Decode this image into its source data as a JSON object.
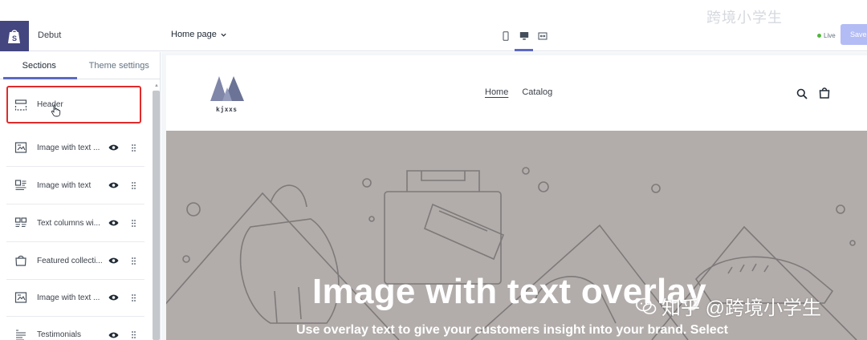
{
  "topbar": {
    "theme_name": "Debut",
    "page_selector": "Home page",
    "live_label": "Live",
    "save_label": "Save",
    "watermark_top": "跨境小学生"
  },
  "sidebar": {
    "tabs": [
      {
        "label": "Sections",
        "active": true
      },
      {
        "label": "Theme settings",
        "active": false
      }
    ],
    "header_item": {
      "label": "Header",
      "icon": "header-layout-icon"
    },
    "items": [
      {
        "label": "Image with text ...",
        "icon": "image-text-icon"
      },
      {
        "label": "Image with text",
        "icon": "image-with-text-icon"
      },
      {
        "label": "Text columns wi...",
        "icon": "text-columns-icon"
      },
      {
        "label": "Featured collecti...",
        "icon": "featured-collection-icon"
      },
      {
        "label": "Image with text ...",
        "icon": "image-text-icon"
      },
      {
        "label": "Testimonials",
        "icon": "testimonials-icon"
      }
    ]
  },
  "preview": {
    "store_name": "kjxxs",
    "nav": [
      {
        "label": "Home"
      },
      {
        "label": "Catalog"
      }
    ],
    "hero_title": "Image with text overlay",
    "hero_subtitle": "Use overlay text to give your customers insight into your brand. Select",
    "watermark": "知乎 @跨境小学生"
  },
  "colors": {
    "accent": "#5c6ac4",
    "shopify_logo_bg": "#43467f",
    "highlight_border": "#e02b2b",
    "hero_bg": "#b2adab",
    "live_dot": "#50b83c"
  }
}
